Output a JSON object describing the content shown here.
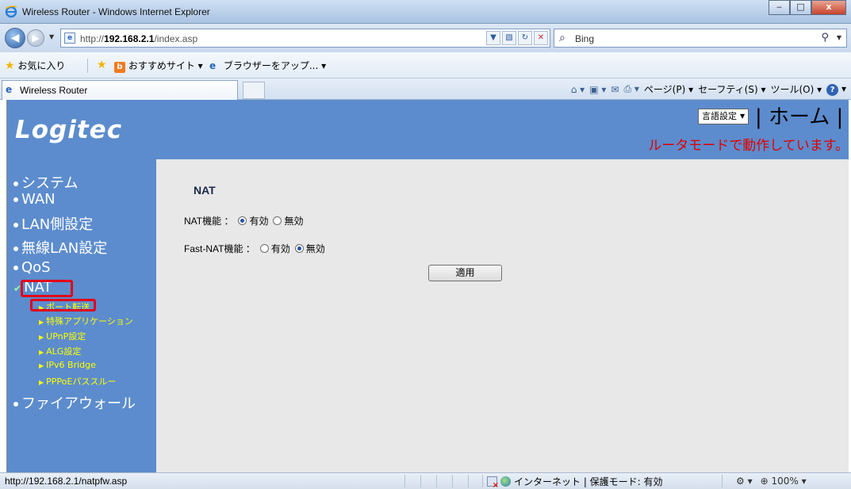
{
  "window": {
    "title": "Wireless Router - Windows Internet Explorer",
    "buttons": {
      "minimize": "‒",
      "maximize": "□",
      "close": "x"
    }
  },
  "address": {
    "url_prefix": "http://",
    "url_host": "192.168.2.1",
    "url_path": "/index.asp"
  },
  "search": {
    "placeholder": "Bing"
  },
  "favorites": {
    "label": "お気に入り",
    "item1": "おすすめサイト ▾",
    "item2": "ブラウザーをアップ... ▾"
  },
  "tab": {
    "label": "Wireless Router"
  },
  "commands": {
    "page": "ページ(P) ▾",
    "safety": "セーフティ(S) ▾",
    "tools": "ツール(O) ▾"
  },
  "header": {
    "logo": "Logitec",
    "language_select": "言語設定",
    "home": "| ホーム |",
    "mode_message": "ルータモードで動作しています。"
  },
  "sidebar": {
    "items": [
      {
        "label": "システム"
      },
      {
        "label": "WAN"
      },
      {
        "label": "LAN側設定"
      },
      {
        "label": "無線LAN設定"
      },
      {
        "label": "QoS"
      },
      {
        "label": "NAT"
      },
      {
        "label": "ファイアウォール"
      }
    ],
    "nat_sub": [
      {
        "label": "ポート転送"
      },
      {
        "label": "特殊アプリケーション"
      },
      {
        "label": "UPnP設定"
      },
      {
        "label": "ALG設定"
      },
      {
        "label": "IPv6 Bridge"
      },
      {
        "label": "PPPoEパススルー"
      }
    ]
  },
  "content": {
    "title": "NAT",
    "nat_function": {
      "label": "NAT機能 ：",
      "enabled": "有効",
      "disabled": "無効",
      "selected": "enabled"
    },
    "fast_nat_function": {
      "label": "Fast-NAT機能 ：",
      "enabled": "有効",
      "disabled": "無効",
      "selected": "disabled"
    },
    "apply_button": "適用"
  },
  "statusbar": {
    "url": "http://192.168.2.1/natpfw.asp",
    "zone": "インターネット | 保護モード: 有効",
    "zoom": "100%"
  }
}
